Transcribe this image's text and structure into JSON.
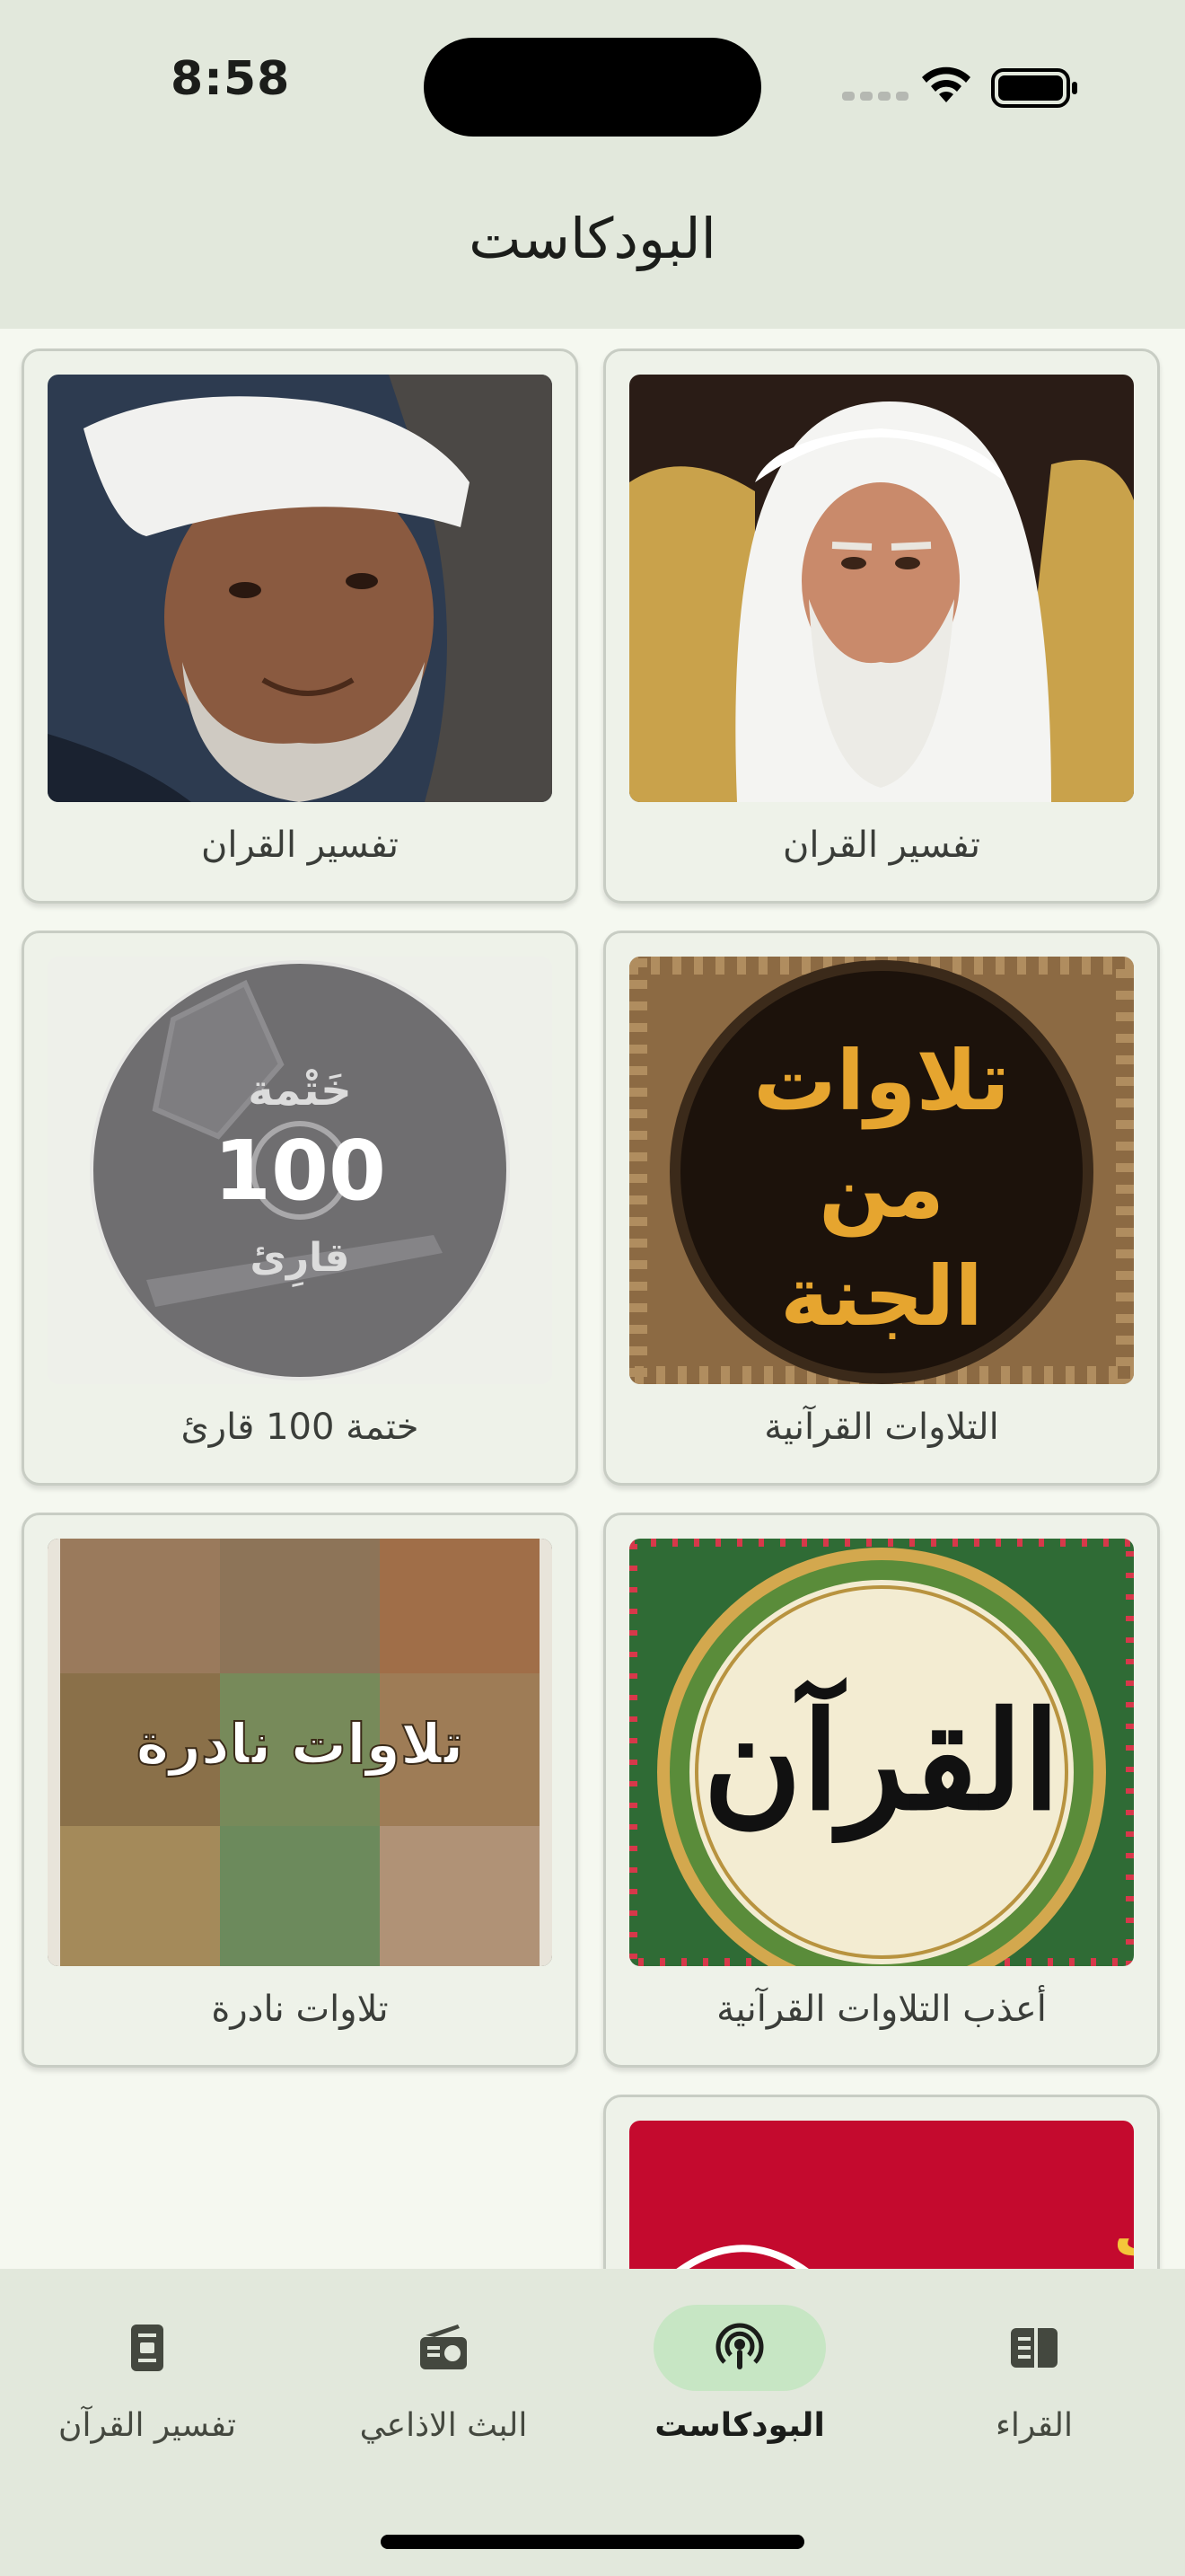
{
  "status_bar": {
    "time": "8:58"
  },
  "header": {
    "title": "البودكاست"
  },
  "podcasts": [
    {
      "label": "تفسير القران",
      "image": "sheikh-portrait-white-ghutra"
    },
    {
      "label": "تفسير القران",
      "image": "sheikh-portrait-white-cap"
    },
    {
      "label": "التلاوات القرآنية",
      "image_text": [
        "تلاوات",
        "من",
        "الجنة"
      ]
    },
    {
      "label": "ختمة 100 قارئ",
      "image_text": [
        "خَتْمة",
        "100",
        "قارِئ"
      ]
    },
    {
      "label": "أعذب التلاوات القرآنية",
      "image_text": [
        "القرآن"
      ]
    },
    {
      "label": "تلاوات نادرة",
      "image_text": [
        "تلاوات نادرة"
      ]
    },
    {
      "label": "",
      "image_text": [
        "إذاعة صوت"
      ]
    }
  ],
  "bottom_nav": {
    "items": [
      {
        "label": "القراء",
        "icon": "book-list-icon",
        "active": false
      },
      {
        "label": "البودكاست",
        "icon": "podcast-icon",
        "active": true
      },
      {
        "label": "البث الاذاعي",
        "icon": "radio-icon",
        "active": false
      },
      {
        "label": "تفسير القرآن",
        "icon": "mushaf-icon",
        "active": false
      }
    ]
  },
  "colors": {
    "background": "#f5f8f0",
    "bar": "#e2e8dc",
    "active_pill": "#c7e6c4",
    "card": "#eef2e9"
  }
}
